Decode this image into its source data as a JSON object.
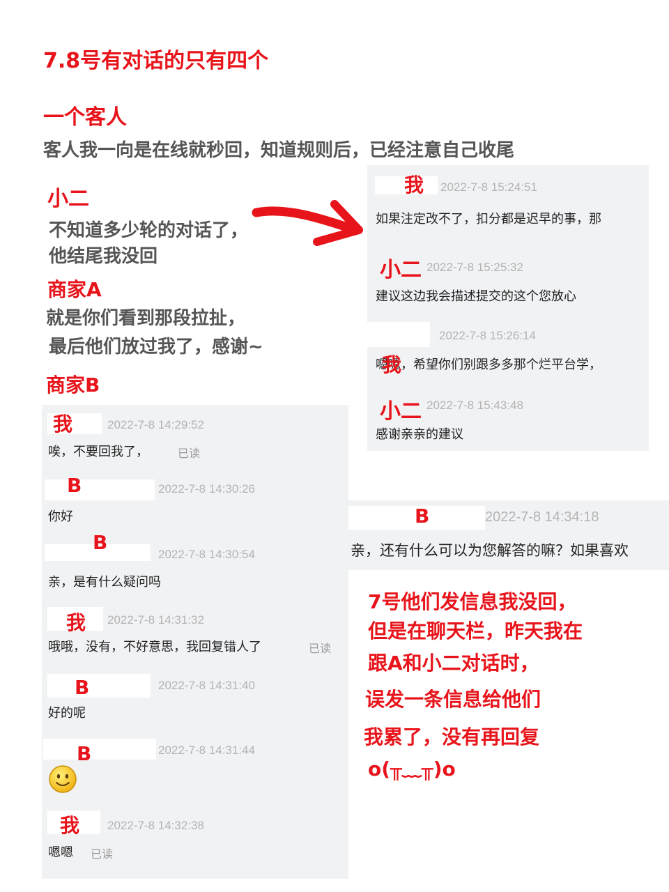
{
  "title": "7.8号有对话的只有四个",
  "guest": {
    "heading": "一个客人",
    "desc": "客人我一向是在线就秒回，知道规则后，已经注意自己收尾"
  },
  "xiaoer": {
    "heading": "小二",
    "desc_line1": "不知道多少轮的对话了，",
    "desc_line2": "他结尾我没回"
  },
  "shopA": {
    "heading": "商家A",
    "desc_line1": "就是你们看到那段拉扯，",
    "desc_line2": "最后他们放过我了，感谢~"
  },
  "shopB": {
    "heading": "商家B"
  },
  "right_chat": {
    "messages": [
      {
        "tag": "我",
        "time": "2022-7-8 15:24:51",
        "text": "如果注定改不了，扣分都是迟早的事，那"
      },
      {
        "tag": "小二",
        "time": "2022-7-8 15:25:32",
        "text": "建议这边我会描述提交的这个您放心"
      },
      {
        "tag": "",
        "time": "2022-7-8 15:26:14",
        "text": "嗯嗯，希望你们别跟多多那个烂平台学，"
      },
      {
        "tag": "小二",
        "time": "2022-7-8 15:43:48",
        "text": "感谢亲亲的建议"
      }
    ],
    "overlay_tag": "我"
  },
  "left_chat": {
    "read_label": "已读",
    "messages": [
      {
        "tag": "我",
        "time": "2022-7-8 14:29:52",
        "text": "唉，不要回我了，",
        "read": true
      },
      {
        "tag": "B",
        "time": "2022-7-8 14:30:26",
        "text": "你好",
        "read": false
      },
      {
        "tag": "B",
        "time": "2022-7-8 14:30:54",
        "text": "亲，是有什么疑问吗",
        "read": false
      },
      {
        "tag": "我",
        "time": "2022-7-8 14:31:32",
        "text": "哦哦，没有，不好意思，我回复错人了",
        "read": true
      },
      {
        "tag": "B",
        "time": "2022-7-8 14:31:40",
        "text": "好的呢",
        "read": false
      },
      {
        "tag": "B",
        "time": "2022-7-8 14:31:44",
        "text": "",
        "emoji": "smiley-emoji",
        "read": false
      },
      {
        "tag": "我",
        "time": "2022-7-8 14:32:38",
        "text": "嗯嗯",
        "read": true
      }
    ]
  },
  "mid_chat": {
    "tag": "B",
    "time": "2022-7-8 14:34:18",
    "text": "亲，还有什么可以为您解答的嘛？如果喜欢"
  },
  "note": {
    "line1": "7号他们发信息我没回，",
    "line2": "但是在聊天栏，昨天我在",
    "line3": "跟A和小二对话时，",
    "line4": "误发一条信息给他们",
    "line5": "我累了，没有再回复",
    "line6": "o(╥﹏╥)o"
  },
  "colors": {
    "accent": "#e8141b",
    "panel": "#f1f2f4",
    "timestamp": "#b3b3b3"
  },
  "icons": {
    "arrow": "red-arrow-icon",
    "emoji": "smiley-emoji"
  }
}
